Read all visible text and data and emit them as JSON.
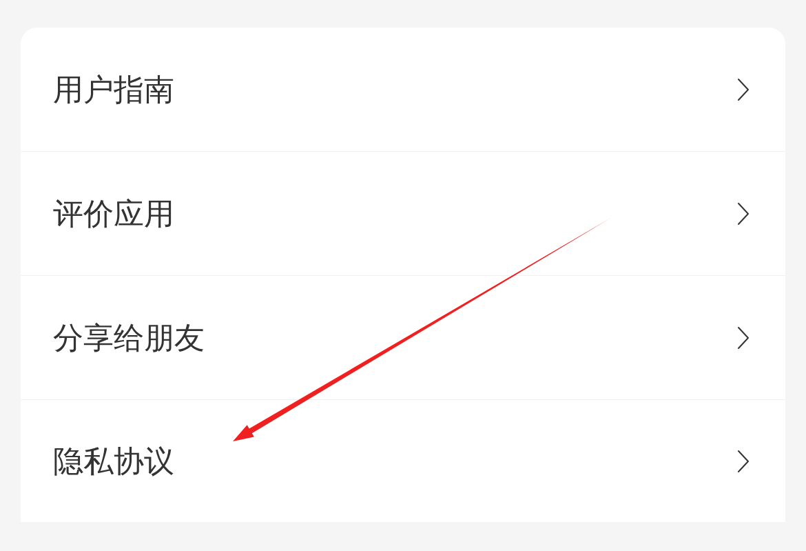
{
  "menu": [
    {
      "label": "用户指南"
    },
    {
      "label": "评价应用"
    },
    {
      "label": "分享给朋友"
    },
    {
      "label": "隐私协议"
    }
  ]
}
